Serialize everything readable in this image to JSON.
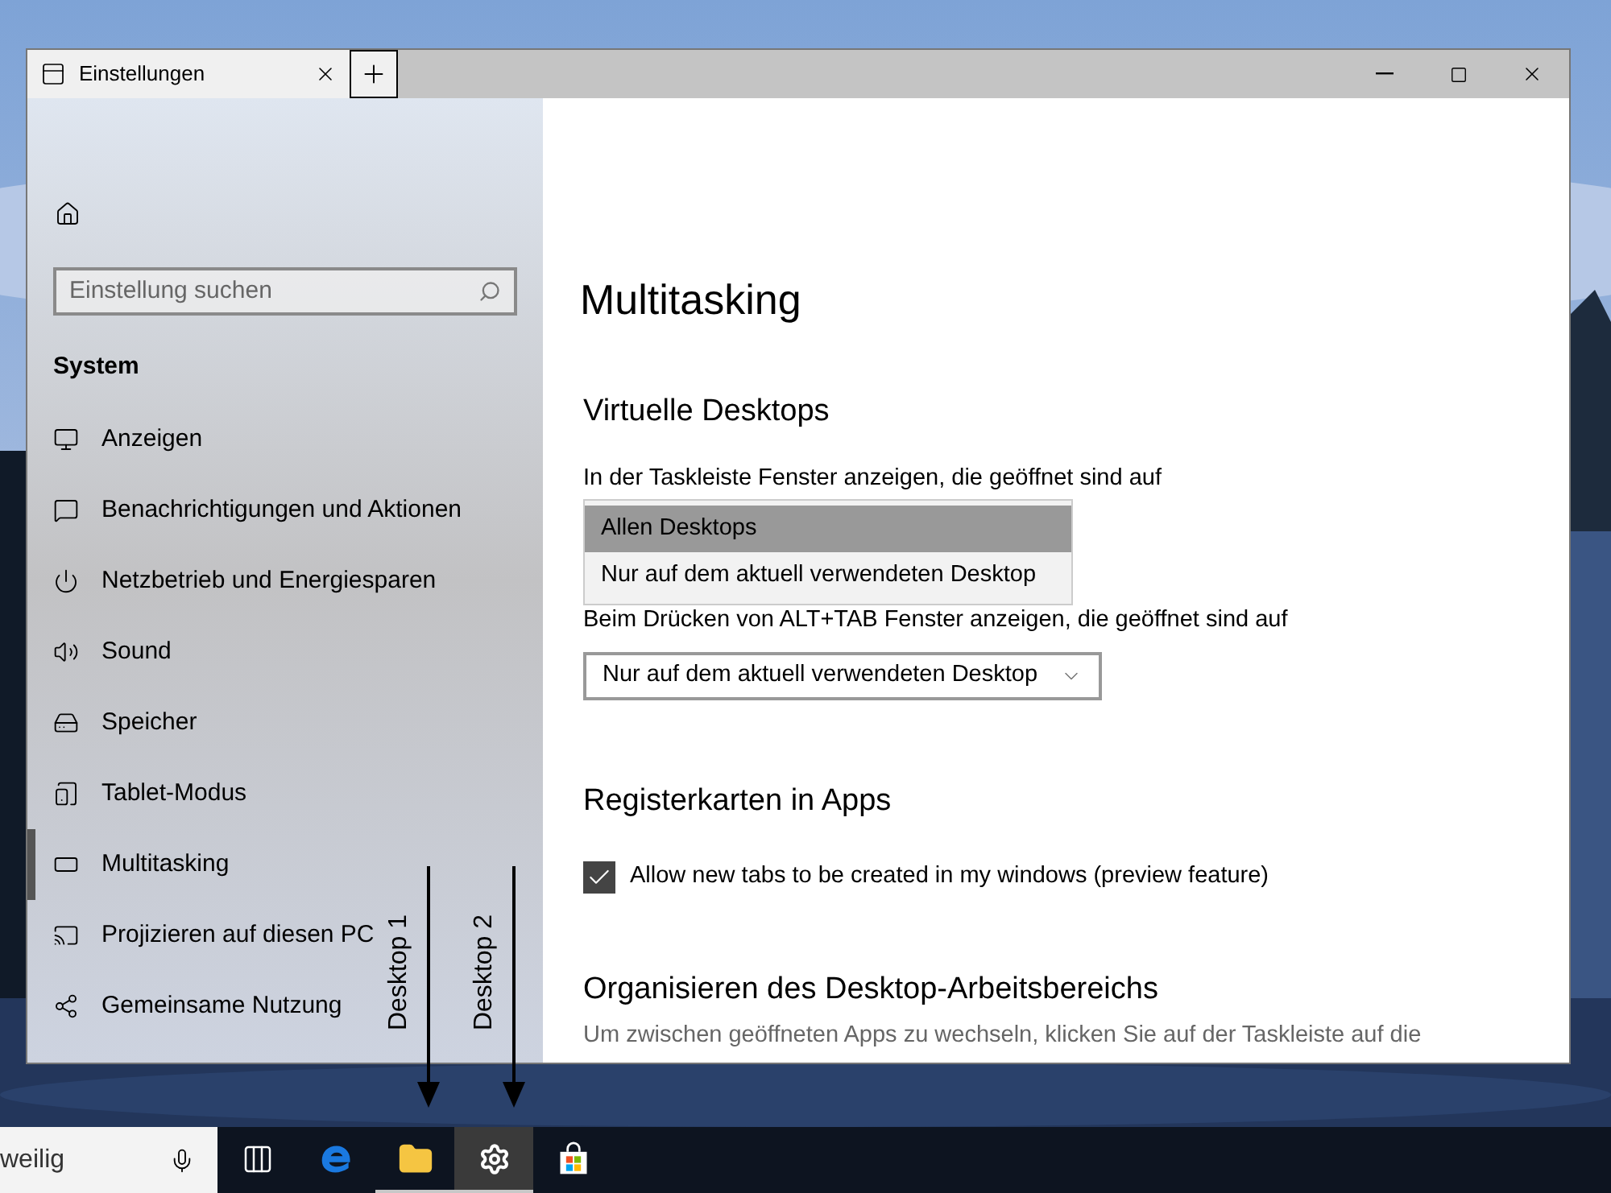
{
  "window": {
    "tab_title": "Einstellungen"
  },
  "sidebar": {
    "search": {
      "placeholder": "Einstellung suchen"
    },
    "section": "System",
    "items": [
      {
        "label": "Anzeigen",
        "kind": "display",
        "selected": false
      },
      {
        "label": "Benachrichtigungen und Aktionen",
        "kind": "notification",
        "selected": false
      },
      {
        "label": "Netzbetrieb und Energiesparen",
        "kind": "power",
        "selected": false
      },
      {
        "label": "Sound",
        "kind": "sound",
        "selected": false
      },
      {
        "label": "Speicher",
        "kind": "storage",
        "selected": false
      },
      {
        "label": "Tablet-Modus",
        "kind": "tablet",
        "selected": false
      },
      {
        "label": "Multitasking",
        "kind": "multitasking",
        "selected": true
      },
      {
        "label": "Projizieren auf diesen PC",
        "kind": "project",
        "selected": false
      },
      {
        "label": "Gemeinsame Nutzung",
        "kind": "share",
        "selected": false
      }
    ]
  },
  "content": {
    "title": "Multitasking",
    "virtual_desktops": {
      "heading": "Virtuelle Desktops",
      "taskbar_setting": {
        "label": "In der Taskleiste Fenster anzeigen, die geöffnet sind auf",
        "expanded": true,
        "options": [
          {
            "label": "Allen Desktops",
            "selected": true
          },
          {
            "label": "Nur auf dem aktuell verwendeten Desktop",
            "selected": false
          }
        ]
      },
      "alttab_setting": {
        "label": "Beim Drücken von ALT+TAB Fenster anzeigen, die geöffnet sind auf",
        "value": "Nur auf dem aktuell verwendeten Desktop"
      }
    },
    "tabs_in_apps": {
      "heading": "Registerkarten in Apps",
      "checkbox": {
        "label": "Allow new tabs to be created in my windows (preview feature)",
        "checked": true
      }
    },
    "workspace": {
      "heading": "Organisieren des Desktop-Arbeitsbereichs",
      "description": "Um zwischen geöffneten Apps zu wechseln, klicken Sie auf der Taskleiste auf die"
    }
  },
  "taskbar": {
    "search_text": "weilig",
    "apps": [
      {
        "kind": "taskview",
        "selected": false,
        "running": false
      },
      {
        "kind": "edge",
        "selected": false,
        "running": false
      },
      {
        "kind": "explorer",
        "selected": false,
        "running": true
      },
      {
        "kind": "settings",
        "selected": true,
        "running": true
      },
      {
        "kind": "store",
        "selected": false,
        "running": false
      }
    ]
  },
  "annotations": [
    "Desktop 1",
    "Desktop 2"
  ]
}
